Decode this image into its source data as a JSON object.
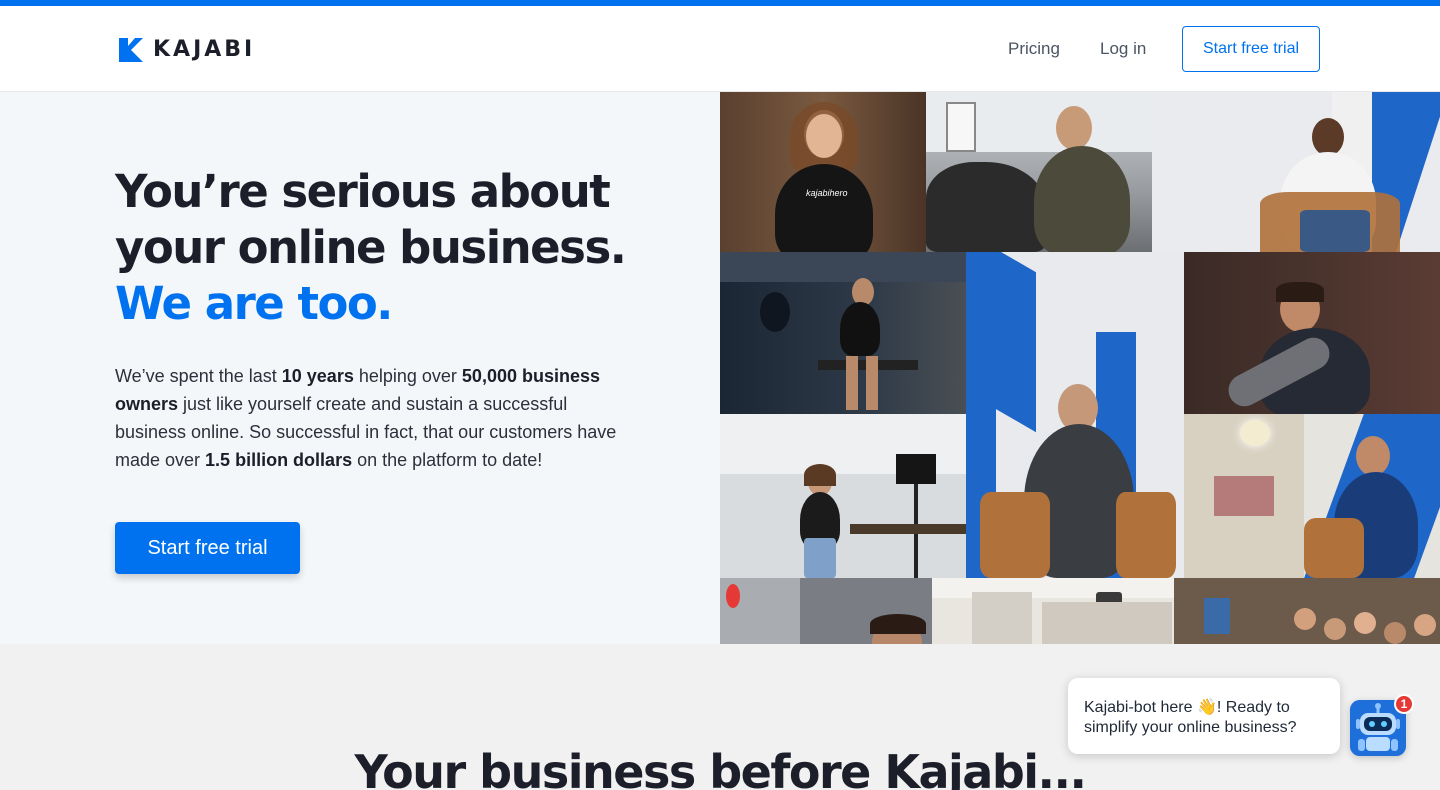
{
  "colors": {
    "brand_blue": "#0072ef",
    "headline_dark": "#1c1e29",
    "hero_background": "#f4f7fa",
    "notification_red": "#e53935"
  },
  "header": {
    "logo_text": "KAJABI",
    "logo_icon": "kajabi-k-icon",
    "nav": {
      "pricing": "Pricing",
      "login": "Log in",
      "cta": "Start free trial"
    }
  },
  "hero": {
    "title_line_1": "You’re serious about",
    "title_line_2": "your online business.",
    "title_accent": "We are too.",
    "body": {
      "t1": "We’ve spent the last ",
      "b1": "10 years",
      "t2": " helping over ",
      "b2": "50,000 business owners",
      "t3": " just like yourself create and sustain a successful business online. So successful in fact, that our customers have made over ",
      "b3": "1.5 billion dollars",
      "t4": " on the platform to date!"
    },
    "cta": "Start free trial"
  },
  "collage": {
    "shirt_text": "kajabihero"
  },
  "section_two": {
    "title": "Your business before Kajabi..."
  },
  "chat": {
    "message_part_1": "Kajabi-bot here ",
    "wave_emoji": "👋",
    "message_part_2": "! Ready to simplify your online business?",
    "badge_count": "1",
    "avatar_icon": "robot-icon"
  }
}
